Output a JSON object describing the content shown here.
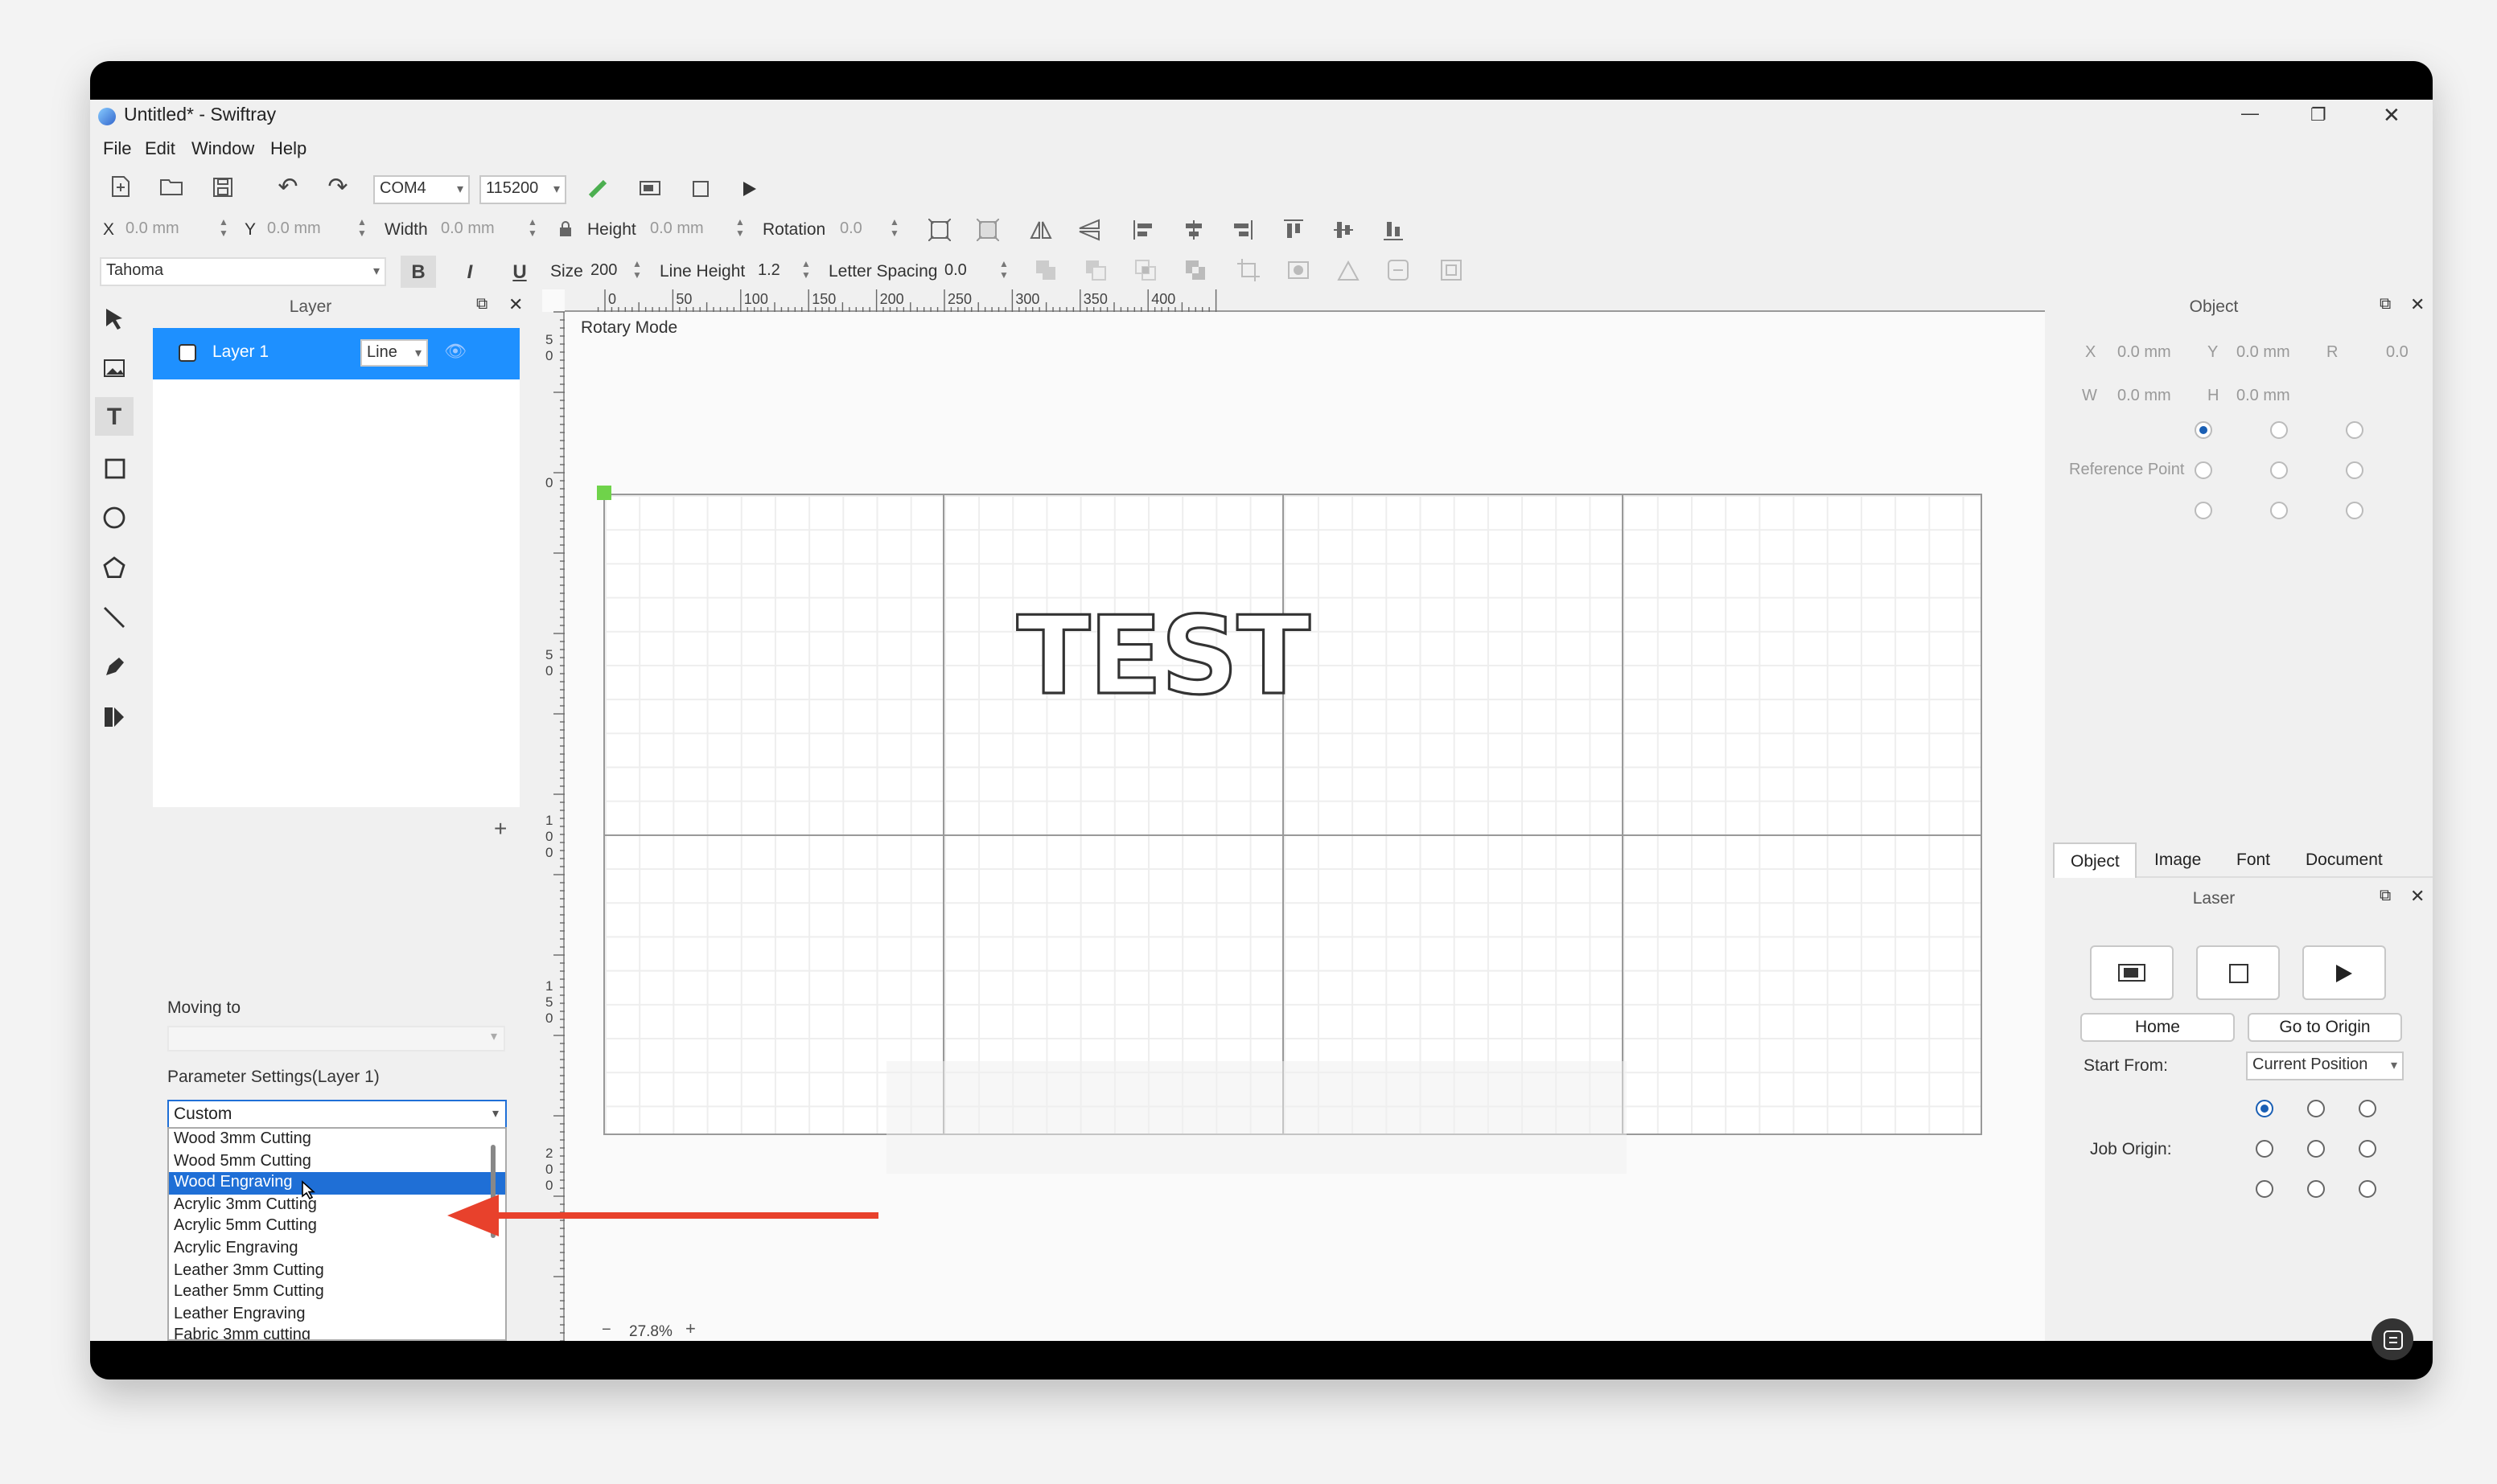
{
  "window": {
    "title": "Untitled* - Swiftray",
    "controls": {
      "minimize": "—",
      "maximize": "❐",
      "close": "✕"
    }
  },
  "menu": [
    "File",
    "Edit",
    "Window",
    "Help"
  ],
  "toolbar": {
    "port": "COM4",
    "baud": "115200"
  },
  "props": {
    "x_label": "X",
    "x_value": "0.0 mm",
    "y_label": "Y",
    "y_value": "0.0 mm",
    "width_label": "Width",
    "width_value": "0.0 mm",
    "height_label": "Height",
    "height_value": "0.0 mm",
    "rotation_label": "Rotation",
    "rotation_value": "0.0"
  },
  "font_bar": {
    "font": "Tahoma",
    "bold": "B",
    "italic": "I",
    "underline": "U",
    "size_label": "Size",
    "size_value": "200",
    "line_height_label": "Line Height",
    "line_height_value": "1.2",
    "letter_spacing_label": "Letter Spacing",
    "letter_spacing_value": "0.0"
  },
  "layer_panel": {
    "title": "Layer",
    "layer_name": "Layer 1",
    "layer_mode": "Line",
    "add": "+"
  },
  "moving": {
    "label": "Moving to"
  },
  "params": {
    "label": "Parameter Settings(Layer 1)",
    "selected": "Custom",
    "options": [
      "Wood 3mm Cutting",
      "Wood 5mm Cutting",
      "Wood Engraving",
      "Acrylic 3mm Cutting",
      "Acrylic 5mm Cutting",
      "Acrylic Engraving",
      "Leather 3mm Cutting",
      "Leather 5mm Cutting",
      "Leather Engraving",
      "Fabric 3mm cutting"
    ],
    "highlighted": "Wood Engraving"
  },
  "canvas": {
    "mode_label": "Rotary Mode",
    "text": "TEST",
    "zoom": "27.8%",
    "zoom_minus": "−",
    "zoom_plus": "+",
    "ruler_x": [
      "0",
      "50",
      "100",
      "150",
      "200",
      "250",
      "300",
      "350",
      "400"
    ],
    "ruler_y": [
      "5",
      "0",
      "0",
      "5",
      "0",
      "1",
      "0",
      "0",
      "1",
      "5",
      "0",
      "2",
      "0",
      "0"
    ]
  },
  "object_panel": {
    "title": "Object",
    "x_label": "X",
    "x_value": "0.0 mm",
    "y_label": "Y",
    "y_value": "0.0 mm",
    "r_label": "R",
    "r_value": "0.0",
    "w_label": "W",
    "w_value": "0.0 mm",
    "h_label": "H",
    "h_value": "0.0 mm",
    "reference_point": "Reference Point"
  },
  "tabs": [
    "Object",
    "Image",
    "Font",
    "Document"
  ],
  "laser_panel": {
    "title": "Laser",
    "home": "Home",
    "go_to_origin": "Go to Origin",
    "start_from_label": "Start From:",
    "start_from_value": "Current Position",
    "job_origin_label": "Job Origin:"
  },
  "colors": {
    "accent": "#1f6fd6",
    "annotation_arrow": "#e8412c",
    "handle": "#6fd34a"
  }
}
